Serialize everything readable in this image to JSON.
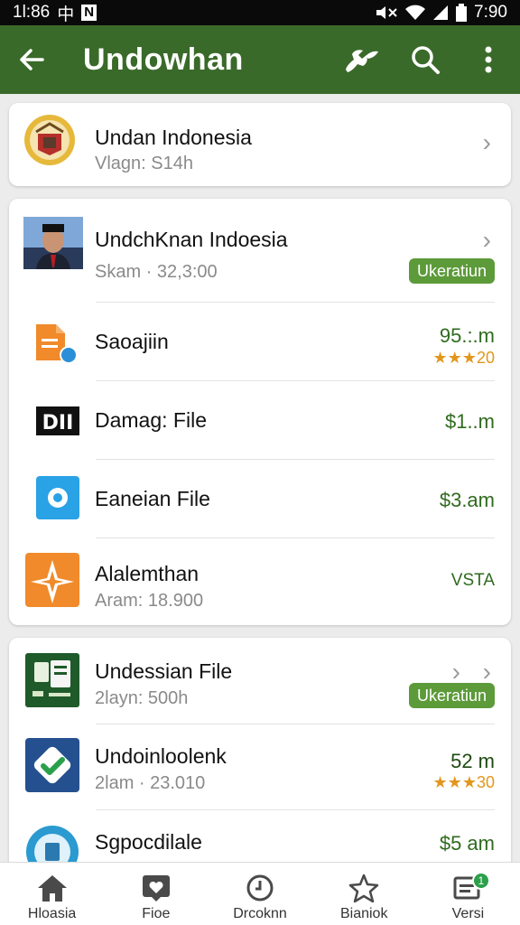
{
  "status": {
    "time_left": "1l:86",
    "glyph": "中",
    "badge": "N",
    "time_right": "7:90"
  },
  "appbar": {
    "title": "Undowhan"
  },
  "card1": {
    "name": "Undan Indonesia",
    "sub": "Vlagn: S14h"
  },
  "card2": {
    "header": {
      "name": "UndchKnan Indoesia",
      "sub": "Skam · 32,3:00",
      "pill": "Ukeratiun"
    },
    "items": [
      {
        "name": "Saoajiin",
        "price": "95.:.m",
        "stars": "★★★",
        "rating": "20"
      },
      {
        "name": "Damag: File",
        "price": "$1..m"
      },
      {
        "name": "Eaneian File",
        "price": "$3.am"
      },
      {
        "name": "Alalemthan",
        "sub": "Aram: 18.900",
        "price": "VSTA"
      }
    ]
  },
  "card3": {
    "items": [
      {
        "name": "Undessian File",
        "sub": "2layn: 500h",
        "pill": "Ukeratiun"
      },
      {
        "name": "Undoinloolenk",
        "sub": "2lam · 23.010",
        "price": "52 m",
        "stars": "★★★",
        "rating": "30"
      },
      {
        "name": "Sgpocdilale",
        "price": "$5 am"
      }
    ]
  },
  "bottomnav": [
    {
      "label": "Hloasia",
      "icon": "home-icon"
    },
    {
      "label": "Fioe",
      "icon": "heart-icon"
    },
    {
      "label": "Drcoknn",
      "icon": "clock-icon"
    },
    {
      "label": "Bianiok",
      "icon": "star-icon"
    },
    {
      "label": "Versi",
      "icon": "list-icon",
      "badge": "1"
    }
  ],
  "colors": {
    "appbar": "#3a6a2a",
    "accent": "#5c9a3a",
    "price": "#2f6b1e",
    "stars": "#e3961c"
  }
}
